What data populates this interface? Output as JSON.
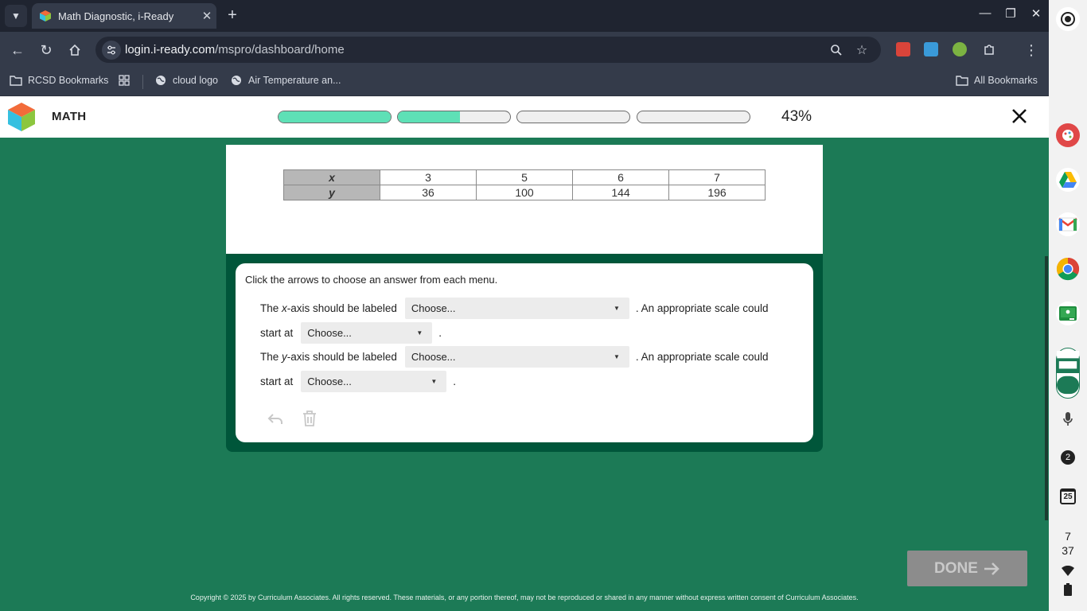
{
  "browser": {
    "tab_title": "Math Diagnostic, i-Ready",
    "url_host": "login.i-ready.com",
    "url_path": "/mspro/dashboard/home",
    "bookmarks": [
      {
        "label": "RCSD Bookmarks",
        "icon": "folder-icon"
      },
      {
        "label": "",
        "icon": "apps-grid-icon"
      },
      {
        "label": "cloud logo",
        "icon": "globe-icon"
      },
      {
        "label": "Air Temperature an...",
        "icon": "globe-icon"
      }
    ],
    "all_bookmarks": "All Bookmarks"
  },
  "app": {
    "subject": "MATH",
    "progress_percent": "43%",
    "progress_segments": [
      1.0,
      0.55,
      0.0,
      0.0
    ],
    "colors": {
      "progress_fill": "#5ee0b6",
      "panel": "#00563a",
      "background": "#1c7a56"
    }
  },
  "table": {
    "x_label": "x",
    "y_label": "y",
    "x_values": [
      "3",
      "5",
      "6",
      "7"
    ],
    "y_values": [
      "36",
      "100",
      "144",
      "196"
    ]
  },
  "question": {
    "instruction": "Click the arrows to choose an answer from each menu.",
    "x_axis_prefix": "The ",
    "x_axis_var": "x",
    "x_axis_suffix": "-axis should be labeled",
    "y_axis_prefix": "The ",
    "y_axis_var": "y",
    "y_axis_suffix": "-axis should be labeled",
    "scale_text": ". An appropriate scale could",
    "start_at": "start at",
    "period": ".",
    "dropdown_placeholder": "Choose...",
    "x_label_choice": "Choose...",
    "x_scale_choice": "Choose...",
    "y_label_choice": "Choose...",
    "y_scale_choice": "Choose..."
  },
  "done_label": "DONE",
  "copyright": "Copyright © 2025 by Curriculum Associates. All rights reserved. These materials, or any portion thereof, may not be reproduced or shared in any manner without express written consent of Curriculum Associates.",
  "shelf": {
    "notification_count": "2",
    "calendar_day": "25",
    "time_hour": "7",
    "time_minute": "37"
  }
}
